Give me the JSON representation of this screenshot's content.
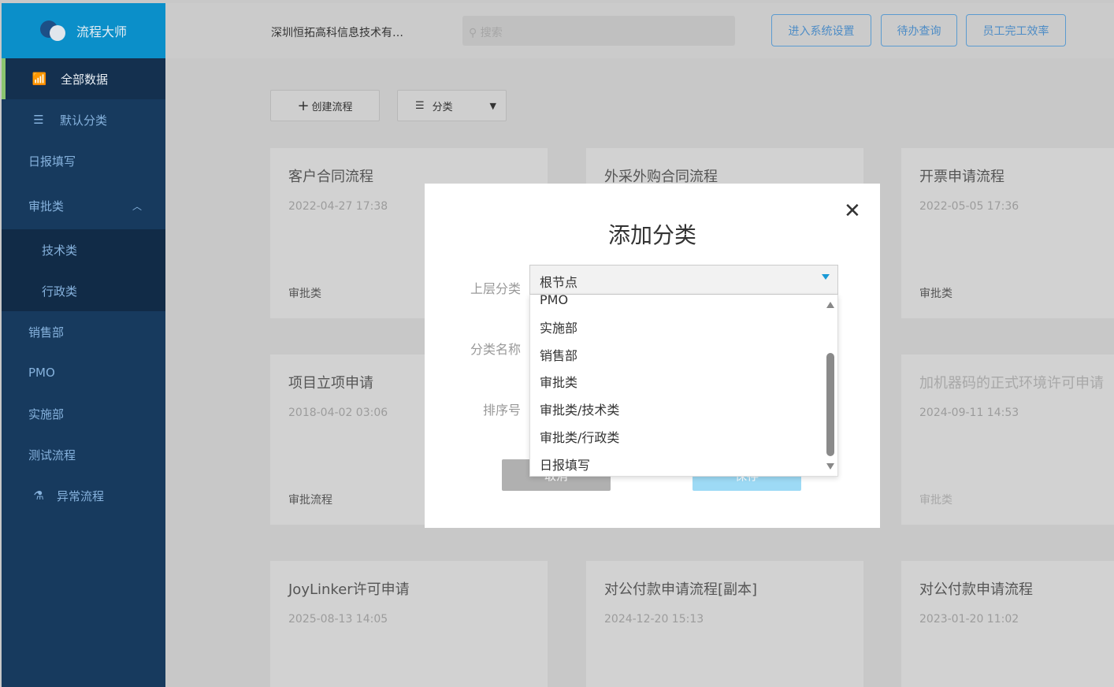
{
  "app": {
    "name": "流程大师"
  },
  "sidebar": {
    "items": [
      {
        "label": "全部数据",
        "icon": "chart-icon"
      },
      {
        "label": "默认分类",
        "icon": "list-icon"
      },
      {
        "label": "日报填写"
      },
      {
        "label": "审批类",
        "expanded": true
      },
      {
        "label": "技术类"
      },
      {
        "label": "行政类"
      },
      {
        "label": "销售部"
      },
      {
        "label": "PMO"
      },
      {
        "label": "实施部"
      },
      {
        "label": "测试流程"
      },
      {
        "label": "异常流程",
        "icon": "flask-icon"
      }
    ]
  },
  "header": {
    "company": "深圳恒拓高科信息技术有…",
    "search_placeholder": "搜索",
    "buttons": [
      "进入系统设置",
      "待办查询",
      "员工完工效率"
    ]
  },
  "toolbar": {
    "create": "创建流程",
    "category": "分类"
  },
  "cards": [
    {
      "title": "客户合同流程",
      "date": "2022-04-27 17:38",
      "category": "审批类"
    },
    {
      "title": "外采外购合同流程",
      "date": "",
      "category": ""
    },
    {
      "title": "开票申请流程",
      "date": "2022-05-05 17:36",
      "category": "审批类"
    },
    {
      "title": "项目立项申请",
      "date": "2018-04-02 03:06",
      "category": "审批流程"
    },
    {
      "title": "",
      "date": "",
      "category": ""
    },
    {
      "title": "加机器码的正式环境许可申请",
      "date": "2024-09-11 14:53",
      "category": "审批类"
    },
    {
      "title": "JoyLinker许可申请",
      "date": "2025-08-13 14:05",
      "category": ""
    },
    {
      "title": "对公付款申请流程[副本]",
      "date": "2024-12-20 15:13",
      "category": ""
    },
    {
      "title": "对公付款申请流程",
      "date": "2023-01-20 11:02",
      "category": ""
    }
  ],
  "modal": {
    "title": "添加分类",
    "labels": {
      "parent": "上层分类",
      "name": "分类名称",
      "order": "排序号"
    },
    "selected": "根节点",
    "options": [
      "PMO",
      "实施部",
      "销售部",
      "审批类",
      "审批类/技术类",
      "审批类/行政类",
      "日报填写"
    ],
    "cancel": "取消",
    "save": "保存"
  }
}
